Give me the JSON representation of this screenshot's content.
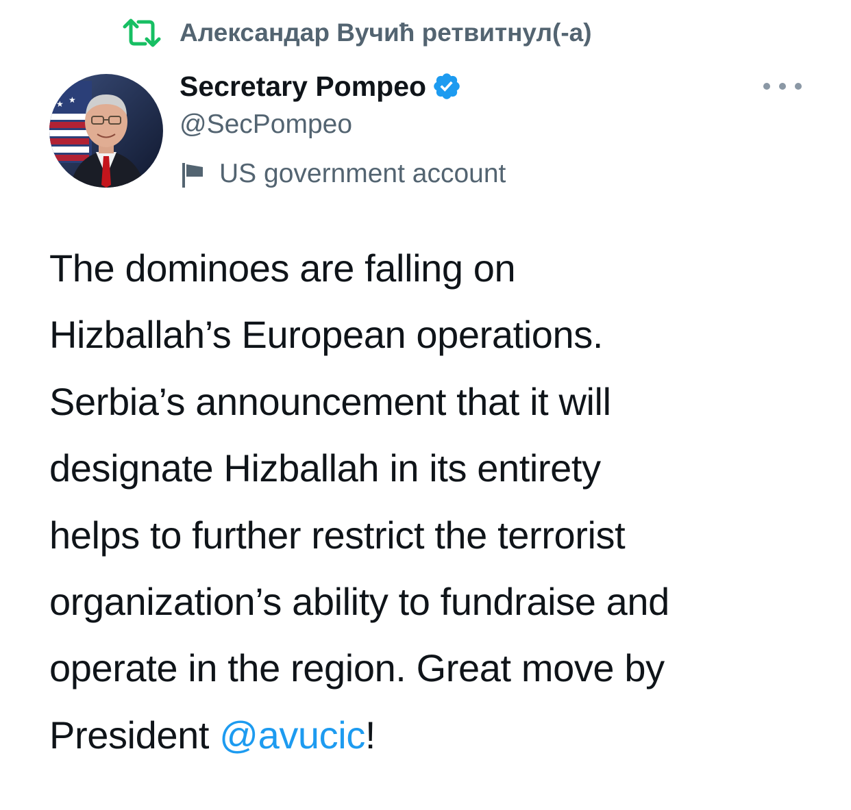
{
  "retweet": {
    "icon": "retweet-icon",
    "text": "Александар Вучић ретвитнул(-а)",
    "icon_color": "#17bf63"
  },
  "author": {
    "display_name": "Secretary Pompeo",
    "handle": "@SecPompeo",
    "verified": true,
    "verified_color": "#1d9bf0",
    "label_icon": "flag-icon",
    "label": "US government account",
    "avatar_icon": "avatar-portrait"
  },
  "menu": {
    "icon": "more-horizontal-icon"
  },
  "tweet": {
    "lines": [
      "The dominoes are falling on",
      "Hizballah’s European operations.",
      "Serbia’s announcement that it will",
      "designate Hizballah in its entirety",
      "helps to further restrict the terrorist",
      "organization’s ability to fundraise and",
      "operate in the region. Great move by"
    ],
    "last_line_prefix": "President ",
    "mention": "@avucic",
    "last_line_suffix": "!",
    "mention_color": "#1d9bf0"
  }
}
